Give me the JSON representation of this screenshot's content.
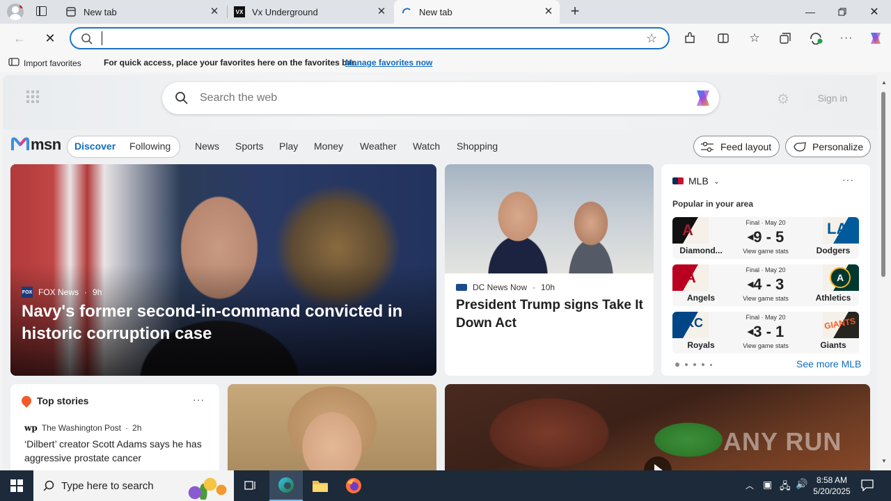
{
  "tabs": [
    {
      "title": "New tab"
    },
    {
      "title": "Vx Underground"
    },
    {
      "title": "New tab"
    }
  ],
  "omnibox": {
    "value": ""
  },
  "favbar": {
    "import_label": "Import favorites",
    "message": "For quick access, place your favorites here on the favorites bar.",
    "manage_link": "Manage favorites now"
  },
  "msn": {
    "search_placeholder": "Search the web",
    "sign_in": "Sign in",
    "logo": "msn",
    "nav": {
      "discover": "Discover",
      "following": "Following",
      "links": [
        "News",
        "Sports",
        "Play",
        "Money",
        "Weather",
        "Watch",
        "Shopping"
      ]
    },
    "feed_layout": "Feed layout",
    "personalize": "Personalize"
  },
  "hero": {
    "source": "FOX News",
    "age": "9h",
    "headline": "Navy's former second-in-command convicted in historic corruption case"
  },
  "story2": {
    "source": "DC News Now",
    "age": "10h",
    "headline": "President Trump signs Take It Down Act"
  },
  "mlb": {
    "title": "MLB",
    "subtitle": "Popular in your area",
    "see_more": "See more MLB",
    "games": [
      {
        "status": "Final · May 20",
        "score": "9 - 5",
        "stats": "View game stats",
        "away": "Diamond...",
        "home": "Dodgers",
        "away_color": "#a71930",
        "home_color": "#005a9c"
      },
      {
        "status": "Final · May 20",
        "score": "4 - 3",
        "stats": "View game stats",
        "away": "Angels",
        "home": "Athletics",
        "away_color": "#ba0021",
        "home_color": "#003831"
      },
      {
        "status": "Final · May 20",
        "score": "3 - 1",
        "stats": "View game stats",
        "away": "Royals",
        "home": "Giants",
        "away_color": "#004687",
        "home_color": "#27251f"
      }
    ]
  },
  "top_stories": {
    "title": "Top stories",
    "source": "The Washington Post",
    "age": "2h",
    "headline": "‘Dilbert’ creator Scott Adams says he has aggressive prostate cancer"
  },
  "watermark": "ANY RUN",
  "taskbar": {
    "search_placeholder": "Type here to search",
    "time": "8:58 AM",
    "date": "5/20/2025"
  },
  "colors": {
    "accent": "#0f6cbd",
    "omnibox_border": "#1a73c9",
    "taskbar": "#1c2a3a"
  }
}
